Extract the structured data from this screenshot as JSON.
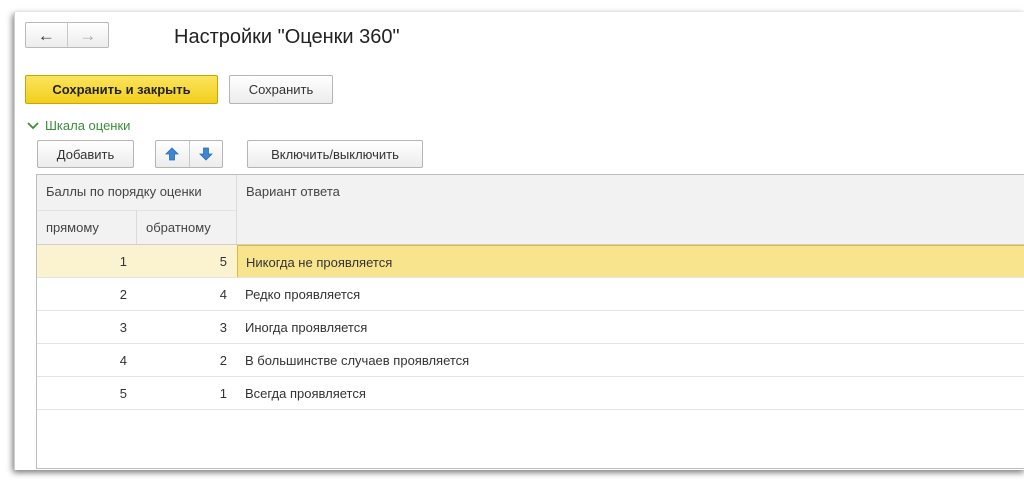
{
  "nav": {
    "back_icon": "arrow-left-icon",
    "forward_icon": "arrow-right-icon"
  },
  "title": "Настройки \"Оценки 360\"",
  "toolbar": {
    "save_close_label": "Сохранить и закрыть",
    "save_label": "Сохранить"
  },
  "group": {
    "label": "Шкала оценки",
    "icon": "chevron-down-icon"
  },
  "table_toolbar": {
    "add_label": "Добавить",
    "move_up_icon": "arrow-up-icon",
    "move_down_icon": "arrow-down-icon",
    "toggle_label": "Включить/выключить"
  },
  "table": {
    "header_group": "Баллы по порядку оценки",
    "col_direct": "прямому",
    "col_reverse": "обратному",
    "col_answer": "Вариант ответа",
    "rows": [
      {
        "direct": "1",
        "reverse": "5",
        "answer": "Никогда не проявляется"
      },
      {
        "direct": "2",
        "reverse": "4",
        "answer": "Редко проявляется"
      },
      {
        "direct": "3",
        "reverse": "3",
        "answer": "Иногда проявляется"
      },
      {
        "direct": "4",
        "reverse": "2",
        "answer": "В большинстве случаев проявляется"
      },
      {
        "direct": "5",
        "reverse": "1",
        "answer": "Всегда проявляется"
      }
    ]
  },
  "colors": {
    "primary_button": "#f5d52a",
    "group_label": "#3a8d3a",
    "arrow_blue": "#3d86d6",
    "selection": "#f9e48e"
  }
}
